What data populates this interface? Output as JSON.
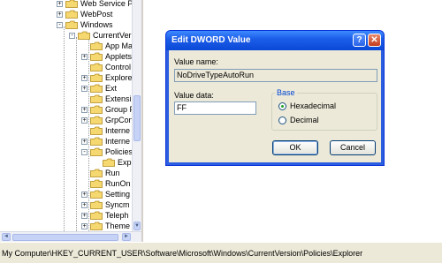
{
  "tree": {
    "items": [
      {
        "label": "Web Service Pr",
        "expander": "+"
      },
      {
        "label": "WebPost",
        "expander": "+"
      },
      {
        "label": "Windows",
        "expander": "-"
      },
      {
        "label": "CurrentVer",
        "expander": "-"
      },
      {
        "label": "App Ma",
        "expander": ""
      },
      {
        "label": "Applets",
        "expander": "+"
      },
      {
        "label": "Control",
        "expander": ""
      },
      {
        "label": "Explore",
        "expander": "+"
      },
      {
        "label": "Ext",
        "expander": "+"
      },
      {
        "label": "Extensi",
        "expander": ""
      },
      {
        "label": "Group F",
        "expander": "+"
      },
      {
        "label": "GrpCon",
        "expander": "+"
      },
      {
        "label": "Interne",
        "expander": ""
      },
      {
        "label": "Interne",
        "expander": "+"
      },
      {
        "label": "Policies",
        "expander": "-"
      },
      {
        "label": "Exp",
        "expander": ""
      },
      {
        "label": "Run",
        "expander": ""
      },
      {
        "label": "RunOn",
        "expander": ""
      },
      {
        "label": "Setting",
        "expander": "+"
      },
      {
        "label": "Syncm",
        "expander": "+"
      },
      {
        "label": "Teleph",
        "expander": "+"
      },
      {
        "label": "Theme",
        "expander": "+"
      }
    ]
  },
  "status_bar": {
    "path": "My Computer\\HKEY_CURRENT_USER\\Software\\Microsoft\\Windows\\CurrentVersion\\Policies\\Explorer"
  },
  "dialog": {
    "title": "Edit DWORD Value",
    "help_label": "?",
    "close_label": "✕",
    "value_name_label": "Value name:",
    "value_name": "NoDriveTypeAutoRun",
    "value_data_label": "Value data:",
    "value_data": "FF",
    "base_label": "Base",
    "radio_hex": "Hexadecimal",
    "radio_dec": "Decimal",
    "selected_base": "Hexadecimal",
    "ok_label": "OK",
    "cancel_label": "Cancel"
  },
  "colors": {
    "title_bar": "#0a48d6",
    "dialog_face": "#ece9d8",
    "group_title": "#0046d5"
  }
}
